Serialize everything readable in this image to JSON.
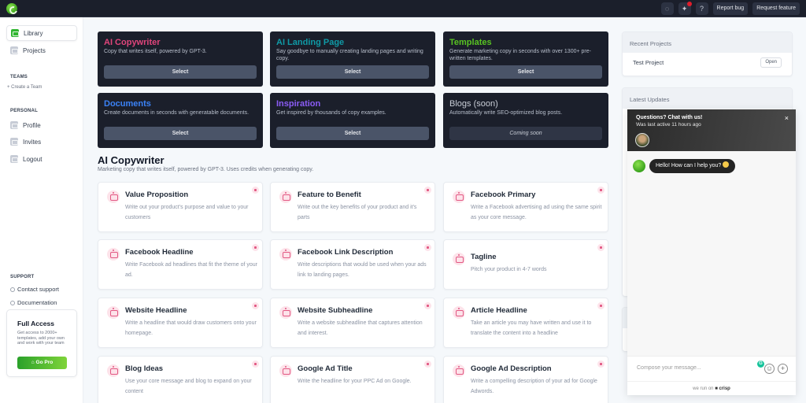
{
  "topbar": {
    "icons": [
      "chat-bubble-icon",
      "sparkle-icon",
      "help-icon"
    ],
    "report_bug": "Report bug",
    "request_feature": "Request feature"
  },
  "sidebar": {
    "nav": [
      {
        "label": "Library",
        "icon": "folder-icon",
        "active": true
      },
      {
        "label": "Projects",
        "icon": "folder-icon",
        "active": false
      }
    ],
    "teams_label": "TEAMS",
    "create_team": "+ Create a Team",
    "personal_label": "PERSONAL",
    "personal": [
      {
        "label": "Profile",
        "icon": "user-icon"
      },
      {
        "label": "Invites",
        "icon": "gift-icon"
      },
      {
        "label": "Logout",
        "icon": "logout-icon"
      }
    ],
    "support_label": "SUPPORT",
    "support": [
      {
        "label": "Contact support",
        "icon": "globe-icon"
      },
      {
        "label": "Documentation",
        "icon": "book-icon"
      }
    ],
    "promo": {
      "title": "Full Access",
      "text": "Get access to 2000+ templates, add your own and work with your team",
      "button": "Go Pro"
    }
  },
  "products": [
    {
      "title": "AI Copywriter",
      "desc": "Copy that writes itself, powered by GPT-3.",
      "button": "Select",
      "color": "#e0457b"
    },
    {
      "title": "AI Landing Page",
      "desc": "Say goodbye to manually creating landing pages and writing copy.",
      "button": "Select",
      "color": "#0f9aa6"
    },
    {
      "title": "Templates",
      "desc": "Generate marketing copy in seconds with over 1300+ pre-written templates.",
      "button": "Select",
      "color": "#58c322"
    },
    {
      "title": "Documents",
      "desc": "Create documents in seconds with generatable documents.",
      "button": "Select",
      "color": "#3b82f6"
    },
    {
      "title": "Inspiration",
      "desc": "Get inspired by thousands of copy examples.",
      "button": "Select",
      "color": "#8b5cf6"
    },
    {
      "title": "Blogs (soon)",
      "desc": "Automatically write SEO-optimized blog posts.",
      "button": "Coming soon",
      "color": "#c8cdd6"
    }
  ],
  "section": {
    "title": "AI Copywriter",
    "subtitle": "Marketing copy that writes itself, powered by GPT-3. Uses credits when generating copy."
  },
  "templates": [
    {
      "title": "Value Proposition",
      "desc": "Write out your product's purpose and value to your customers"
    },
    {
      "title": "Feature to Benefit",
      "desc": "Write out the key benefits of your product and it's parts"
    },
    {
      "title": "Facebook Primary",
      "desc": "Write a Facebook advertising ad using the same spirit as your core message."
    },
    {
      "title": "Facebook Headline",
      "desc": "Write Facebook ad headlines that fit the theme of your ad."
    },
    {
      "title": "Facebook Link Description",
      "desc": "Write descriptions that would be used when your ads link to landing pages."
    },
    {
      "title": "Tagline",
      "desc": "Pitch your product in 4-7 words"
    },
    {
      "title": "Website Headline",
      "desc": "Write a headline that would draw customers onto your homepage."
    },
    {
      "title": "Website Subheadline",
      "desc": "Write a website subheadline that captures attention and interest."
    },
    {
      "title": "Article Headline",
      "desc": "Take an article you may have written and use it to translate the content into a headline"
    },
    {
      "title": "Blog Ideas",
      "desc": "Use your core message and blog to expand on your content"
    },
    {
      "title": "Google Ad Title",
      "desc": "Write the headline for your PPC Ad on Google."
    },
    {
      "title": "Google Ad Description",
      "desc": "Write a compelling description of your ad for Google Adwords."
    }
  ],
  "right": {
    "recent_title": "Recent Projects",
    "project_name": "Test Project",
    "open_label": "Open",
    "updates_title": "Latest Updates"
  },
  "chat": {
    "title": "Questions? Chat with us!",
    "status": "Was last active 11 hours ago",
    "close": "×",
    "message": "Hello! How can I help you?",
    "placeholder": "Compose your message...",
    "footer_prefix": "we run on",
    "footer_brand": "crisp",
    "grammarly": "G",
    "plus": "+"
  }
}
